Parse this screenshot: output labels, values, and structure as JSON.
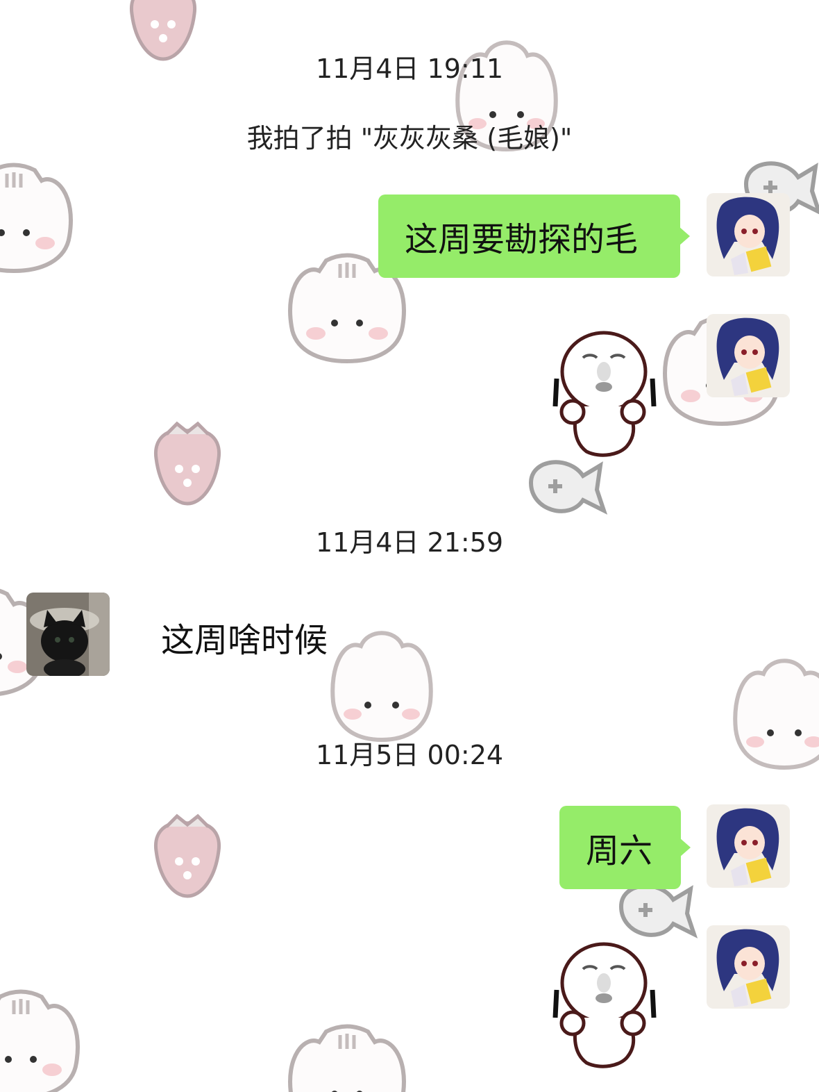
{
  "messages": [
    {
      "type": "timestamp",
      "text": "11月4日 19:11"
    },
    {
      "type": "system",
      "text": "我拍了拍 \"灰灰灰桑 (毛娘)\""
    },
    {
      "type": "outgoing",
      "text": "这周要勘探的毛"
    },
    {
      "type": "outgoing-sticker",
      "sticker": "face-meme-sticker"
    },
    {
      "type": "timestamp",
      "text": "11月4日 21:59"
    },
    {
      "type": "incoming",
      "text": "这周啥时候"
    },
    {
      "type": "timestamp",
      "text": "11月5日 00:24"
    },
    {
      "type": "outgoing",
      "text": "周六"
    },
    {
      "type": "outgoing-sticker",
      "sticker": "face-meme-sticker"
    }
  ],
  "theme": {
    "bubble_out_color": "#95ec69",
    "background_color": "#ffffff",
    "wallpaper": "cute-cat-and-strawberry-pattern"
  },
  "avatars": {
    "self": "anime-girl-avatar",
    "other": "black-cat-avatar"
  }
}
